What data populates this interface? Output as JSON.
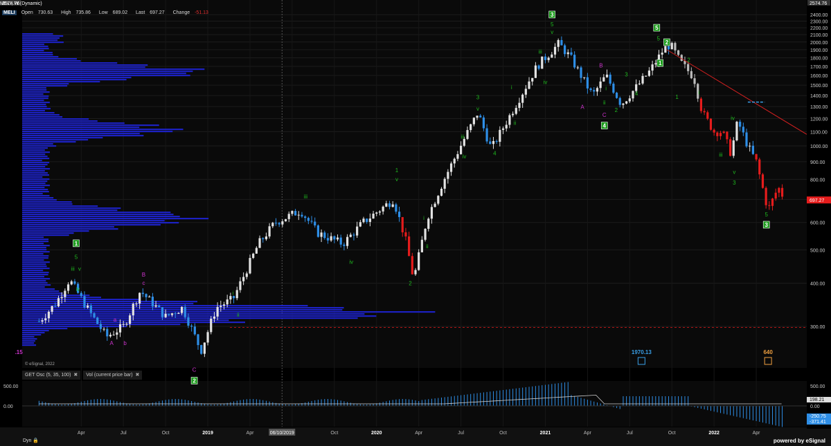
{
  "header": {
    "symbol_line": "MELI, W (Dynamic)",
    "ticker": "MELI",
    "open_label": "Open",
    "open": "730.63",
    "high_label": "High",
    "high": "735.86",
    "low_label": "Low",
    "low": "689.02",
    "last_label": "Last",
    "last": "697.27",
    "change_label": "Change",
    "change": "-51.13"
  },
  "colors": {
    "up": "#e2e2e2",
    "blue": "#2e8ee6",
    "red": "#e51c1c",
    "volume_profile": "#1e23d6",
    "wave_green": "#1fb81f",
    "wave_magenta": "#cc33cc",
    "trendline": "#d42020",
    "last_price": "#e51c1c"
  },
  "chart_data": {
    "type": "candlestick",
    "title": "MELI, W (Dynamic)",
    "y_scale": "log",
    "ylim": [
      240,
      2600
    ],
    "y_ticks": [
      "300.00",
      "400.00",
      "500.00",
      "600.00",
      "700.00",
      "800.00",
      "900.00",
      "1000.00",
      "1100.00",
      "1200.00",
      "1300.00",
      "1400.00",
      "1500.00",
      "1600.00",
      "1700.00",
      "1800.00",
      "1900.00",
      "2000.00",
      "2100.00",
      "2200.00",
      "2300.00",
      "2400.00"
    ],
    "y_top_label": "2574.76",
    "x_ticks": [
      "Apr",
      "Jul",
      "Oct",
      "2019",
      "Apr",
      "Jul",
      "Oct",
      "2020",
      "Apr",
      "Jul",
      "Oct",
      "2021",
      "Apr",
      "Jul",
      "Oct",
      "2022",
      "Apr"
    ],
    "cursor_date": "06/10/2019",
    "last_price": "697.27",
    "grid": true,
    "anchor_points": [
      [
        2018.0,
        310
      ],
      [
        2018.1,
        350
      ],
      [
        2018.18,
        410
      ],
      [
        2018.3,
        330
      ],
      [
        2018.4,
        280
      ],
      [
        2018.5,
        300
      ],
      [
        2018.6,
        380
      ],
      [
        2018.75,
        320
      ],
      [
        2018.85,
        340
      ],
      [
        2018.96,
        255
      ],
      [
        2019.05,
        340
      ],
      [
        2019.15,
        360
      ],
      [
        2019.3,
        520
      ],
      [
        2019.4,
        600
      ],
      [
        2019.55,
        650
      ],
      [
        2019.65,
        560
      ],
      [
        2019.8,
        520
      ],
      [
        2019.92,
        600
      ],
      [
        2020.1,
        700
      ],
      [
        2020.17,
        540
      ],
      [
        2020.22,
        410
      ],
      [
        2020.3,
        620
      ],
      [
        2020.4,
        800
      ],
      [
        2020.52,
        1050
      ],
      [
        2020.6,
        1250
      ],
      [
        2020.68,
        980
      ],
      [
        2020.8,
        1250
      ],
      [
        2020.95,
        1700
      ],
      [
        2021.08,
        1980
      ],
      [
        2021.15,
        1800
      ],
      [
        2021.28,
        1400
      ],
      [
        2021.36,
        1600
      ],
      [
        2021.45,
        1320
      ],
      [
        2021.55,
        1500
      ],
      [
        2021.62,
        1650
      ],
      [
        2021.7,
        1900
      ],
      [
        2021.74,
        1970
      ],
      [
        2021.8,
        1750
      ],
      [
        2021.88,
        1580
      ],
      [
        2021.93,
        1250
      ],
      [
        2022.0,
        1100
      ],
      [
        2022.05,
        1100
      ],
      [
        2022.1,
        950
      ],
      [
        2022.14,
        1180
      ],
      [
        2022.2,
        1000
      ],
      [
        2022.25,
        900
      ],
      [
        2022.32,
        650
      ],
      [
        2022.38,
        760
      ],
      [
        2022.42,
        697
      ]
    ],
    "wave_labels": [
      {
        "t": "1",
        "x": 2018.22,
        "p": 515,
        "c": "green",
        "box": true
      },
      {
        "t": "5",
        "x": 2018.22,
        "p": 470,
        "c": "green"
      },
      {
        "t": "iii",
        "x": 2018.2,
        "p": 435,
        "c": "green"
      },
      {
        "t": "v",
        "x": 2018.24,
        "p": 435,
        "c": "green"
      },
      {
        "t": "iv",
        "x": 2018.23,
        "p": 380,
        "c": "green"
      },
      {
        "t": "a",
        "x": 2018.45,
        "p": 310,
        "c": "magenta"
      },
      {
        "t": "A",
        "x": 2018.43,
        "p": 265,
        "c": "magenta"
      },
      {
        "t": "b",
        "x": 2018.51,
        "p": 265,
        "c": "magenta"
      },
      {
        "t": "B",
        "x": 2018.62,
        "p": 418,
        "c": "magenta"
      },
      {
        "t": "c",
        "x": 2018.62,
        "p": 396,
        "c": "magenta"
      },
      {
        "t": "C",
        "x": 2018.92,
        "p": 222,
        "c": "magenta"
      },
      {
        "t": "2",
        "x": 2018.92,
        "p": 206,
        "c": "green",
        "box": true
      },
      {
        "t": "i",
        "x": 2019.15,
        "p": 370,
        "c": "green"
      },
      {
        "t": "ii",
        "x": 2019.18,
        "p": 320,
        "c": "green"
      },
      {
        "t": "iii",
        "x": 2019.58,
        "p": 705,
        "c": "green"
      },
      {
        "t": "iv",
        "x": 2019.85,
        "p": 455,
        "c": "green"
      },
      {
        "t": "1",
        "x": 2020.12,
        "p": 840,
        "c": "green"
      },
      {
        "t": "v",
        "x": 2020.12,
        "p": 790,
        "c": "green"
      },
      {
        "t": "i",
        "x": 2020.28,
        "p": 610,
        "c": "green"
      },
      {
        "t": "ii",
        "x": 2020.3,
        "p": 505,
        "c": "green"
      },
      {
        "t": "2",
        "x": 2020.2,
        "p": 395,
        "c": "green"
      },
      {
        "t": "3",
        "x": 2020.6,
        "p": 1365,
        "c": "green"
      },
      {
        "t": "v",
        "x": 2020.6,
        "p": 1265,
        "c": "green"
      },
      {
        "t": "iii",
        "x": 2020.51,
        "p": 1050,
        "c": "green"
      },
      {
        "t": "iv",
        "x": 2020.52,
        "p": 920,
        "c": "green"
      },
      {
        "t": "4",
        "x": 2020.7,
        "p": 940,
        "c": "green"
      },
      {
        "t": "i",
        "x": 2020.8,
        "p": 1460,
        "c": "green"
      },
      {
        "t": "ii",
        "x": 2020.82,
        "p": 1150,
        "c": "green"
      },
      {
        "t": "iii",
        "x": 2020.97,
        "p": 1850,
        "c": "green"
      },
      {
        "t": "iv",
        "x": 2021.0,
        "p": 1510,
        "c": "green"
      },
      {
        "t": "3",
        "x": 2021.04,
        "p": 2370,
        "c": "green",
        "box": true
      },
      {
        "t": "5",
        "x": 2021.04,
        "p": 2220,
        "c": "green"
      },
      {
        "t": "v",
        "x": 2021.04,
        "p": 2110,
        "c": "green"
      },
      {
        "t": "A",
        "x": 2021.22,
        "p": 1280,
        "c": "magenta"
      },
      {
        "t": "B",
        "x": 2021.33,
        "p": 1690,
        "c": "magenta"
      },
      {
        "t": "i",
        "x": 2021.36,
        "p": 1450,
        "c": "green"
      },
      {
        "t": "ii",
        "x": 2021.35,
        "p": 1320,
        "c": "green"
      },
      {
        "t": "C",
        "x": 2021.35,
        "p": 1215,
        "c": "magenta"
      },
      {
        "t": "4",
        "x": 2021.35,
        "p": 1130,
        "c": "green",
        "box": true
      },
      {
        "t": "2",
        "x": 2021.42,
        "p": 1255,
        "c": "green"
      },
      {
        "t": "3",
        "x": 2021.48,
        "p": 1590,
        "c": "green"
      },
      {
        "t": "4",
        "x": 2021.54,
        "p": 1400,
        "c": "green"
      },
      {
        "t": "5",
        "x": 2021.66,
        "p": 2170,
        "c": "green",
        "box": true
      },
      {
        "t": "5",
        "x": 2021.67,
        "p": 2020,
        "c": "green"
      },
      {
        "t": "2",
        "x": 2021.72,
        "p": 1970,
        "c": "green",
        "box": true
      },
      {
        "t": "1",
        "x": 2021.68,
        "p": 1715,
        "c": "green",
        "box": true
      },
      {
        "t": "2",
        "x": 2021.85,
        "p": 1750,
        "c": "green"
      },
      {
        "t": "1",
        "x": 2021.78,
        "p": 1370,
        "c": "green"
      },
      {
        "t": "i",
        "x": 2021.91,
        "p": 1410,
        "c": "green"
      },
      {
        "t": "iii",
        "x": 2022.04,
        "p": 930,
        "c": "green"
      },
      {
        "t": "iv",
        "x": 2022.11,
        "p": 1190,
        "c": "green"
      },
      {
        "t": "v",
        "x": 2022.12,
        "p": 830,
        "c": "green"
      },
      {
        "t": "3",
        "x": 2022.12,
        "p": 772,
        "c": "green"
      },
      {
        "t": "5",
        "x": 2022.31,
        "p": 624,
        "c": "green"
      },
      {
        "t": "3",
        "x": 2022.31,
        "p": 583,
        "c": "green",
        "box": true
      }
    ],
    "bottom_labels": [
      {
        "t": ".15",
        "x": 2017.88
      },
      {
        "t": "1970.13",
        "x": 2021.57
      },
      {
        "t": "640",
        "x": 2022.32
      }
    ],
    "volume_profile": {
      "price_range": [
        300,
        2000
      ],
      "peak_price": 330,
      "label": "volume profile"
    },
    "indicator": {
      "title": "GET Osc (5, 35, 100)",
      "ticks": [
        "500.00",
        "0.00"
      ],
      "values": [
        "198.21",
        "-250.75",
        "-371.41"
      ]
    },
    "volume_tab": "Vol (current price bar)"
  },
  "footer": {
    "dyn": "Dyn",
    "powered": "powered by eSignal",
    "copyright": "© eSignal, 2022"
  }
}
